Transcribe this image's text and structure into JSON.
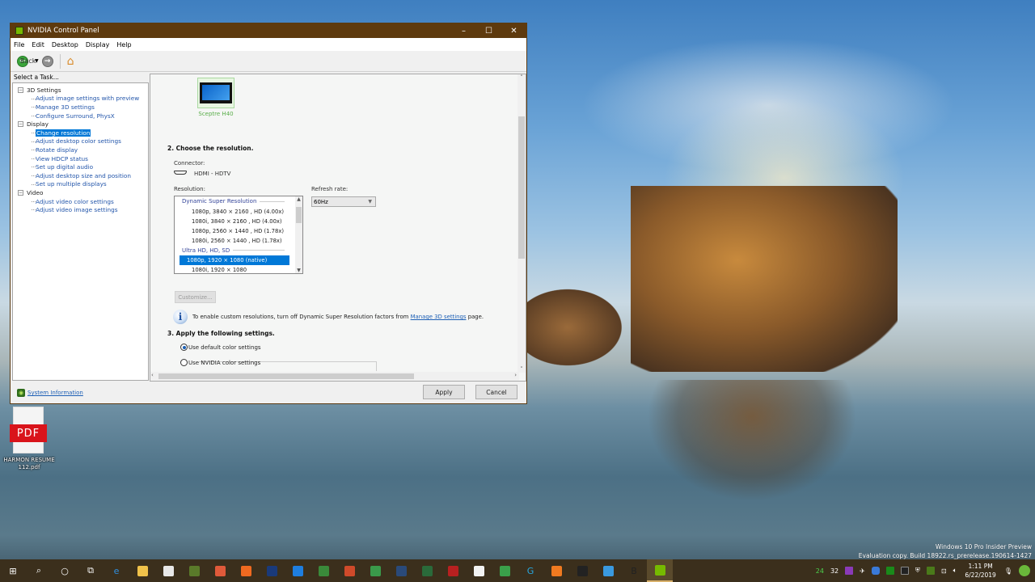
{
  "window": {
    "title": "NVIDIA Control Panel",
    "controls": {
      "minimize": "–",
      "maximize": "☐",
      "close": "✕"
    }
  },
  "menu": [
    "File",
    "Edit",
    "Desktop",
    "Display",
    "Help"
  ],
  "toolbar": {
    "back_label": "Back",
    "dropdown": "▼",
    "back_arrow": "←",
    "forward_arrow": "→",
    "home_glyph": "⌂"
  },
  "task_panel": {
    "heading": "Select a Task...",
    "groups": [
      {
        "label": "3D Settings",
        "items": [
          "Adjust image settings with preview",
          "Manage 3D settings",
          "Configure Surround, PhysX"
        ]
      },
      {
        "label": "Display",
        "items": [
          "Change resolution",
          "Adjust desktop color settings",
          "Rotate display",
          "View HDCP status",
          "Set up digital audio",
          "Adjust desktop size and position",
          "Set up multiple displays"
        ]
      },
      {
        "label": "Video",
        "items": [
          "Adjust video color settings",
          "Adjust video image settings"
        ]
      }
    ],
    "selected": "Change resolution"
  },
  "content": {
    "monitor_name": "Sceptre H40",
    "step2_title": "2. Choose the resolution.",
    "connector_label": "Connector:",
    "connector_value": "HDMI - HDTV",
    "resolution_label": "Resolution:",
    "refresh_label": "Refresh rate:",
    "refresh_value": "60Hz",
    "resolution_list": {
      "group1": "Dynamic Super Resolution",
      "group1_items": [
        "1080p, 3840 × 2160 , HD (4.00x)",
        "1080i, 3840 × 2160 , HD (4.00x)",
        "1080p, 2560 × 1440 , HD (1.78x)",
        "1080i, 2560 × 1440 , HD (1.78x)"
      ],
      "group2": "Ultra HD, HD, SD",
      "group2_items": [
        "1080p, 1920 × 1080 (native)",
        "1080i, 1920 × 1080"
      ],
      "selected": "1080p, 1920 × 1080 (native)"
    },
    "customize_button": "Customize...",
    "info_text_before": "To enable custom resolutions, turn off Dynamic Super Resolution factors from ",
    "info_link": "Manage 3D settings",
    "info_text_after": " page.",
    "step3_title": "3. Apply the following settings.",
    "radio_default": "Use default color settings",
    "radio_nvidia": "Use NVIDIA color settings",
    "radio_selected": "default"
  },
  "footer": {
    "system_info_link": "System Information",
    "apply_button": "Apply",
    "cancel_button": "Cancel"
  },
  "desktop": {
    "pdf_icon_label": "PDF",
    "pdf_file_name": "HARMON RESUME 112.pdf",
    "watermark_line1": "Windows 10 Pro Insider Preview",
    "watermark_line2": "Evaluation copy. Build 18922.rs_prerelease.190614-1427"
  },
  "taskbar": {
    "apps": [
      {
        "name": "start",
        "glyph": "⊞",
        "color": "#ffffff"
      },
      {
        "name": "search",
        "glyph": "⌕",
        "color": "#ffffff"
      },
      {
        "name": "cortana",
        "glyph": "○",
        "color": "#ffffff"
      },
      {
        "name": "task-view",
        "glyph": "⧉",
        "color": "#ffffff"
      },
      {
        "name": "edge",
        "glyph": "e",
        "color": "#2f8fe0"
      },
      {
        "name": "file-explorer",
        "glyph": "",
        "color": "#f0c24a"
      },
      {
        "name": "store",
        "glyph": "",
        "color": "#e8e8e8"
      },
      {
        "name": "game-app",
        "glyph": "",
        "color": "#5a7a2a"
      },
      {
        "name": "app-red",
        "glyph": "",
        "color": "#e05a3a"
      },
      {
        "name": "origin",
        "glyph": "",
        "color": "#f06a20"
      },
      {
        "name": "app-dark-blue",
        "glyph": "",
        "color": "#1a3a7a"
      },
      {
        "name": "uplay",
        "glyph": "",
        "color": "#1e7ee0"
      },
      {
        "name": "xbox",
        "glyph": "",
        "color": "#3a8a3a"
      },
      {
        "name": "ccleaner",
        "glyph": "",
        "color": "#d04a2a"
      },
      {
        "name": "app-multicolor",
        "glyph": "",
        "color": "#3a9a4a"
      },
      {
        "name": "steam",
        "glyph": "",
        "color": "#2a4a7a"
      },
      {
        "name": "terminal",
        "glyph": "",
        "color": "#2a6a3a"
      },
      {
        "name": "app-red-2",
        "glyph": "",
        "color": "#b82020"
      },
      {
        "name": "file",
        "glyph": "",
        "color": "#f2f2f2"
      },
      {
        "name": "chrome",
        "glyph": "",
        "color": "#3aa04a"
      },
      {
        "name": "logitech",
        "glyph": "G",
        "color": "#27a8e0"
      },
      {
        "name": "firefox",
        "glyph": "",
        "color": "#f07a20"
      },
      {
        "name": "epic-games",
        "glyph": "",
        "color": "#222222"
      },
      {
        "name": "phone",
        "glyph": "",
        "color": "#3a9ae0"
      },
      {
        "name": "app-b",
        "glyph": "B",
        "color": "#222222"
      },
      {
        "name": "nvidia",
        "glyph": "",
        "color": "#76b900"
      }
    ],
    "active_app": "nvidia",
    "tray_temp1": "24",
    "tray_temp2": "32",
    "clock_time": "1:11 PM",
    "clock_date": "6/22/2019"
  }
}
